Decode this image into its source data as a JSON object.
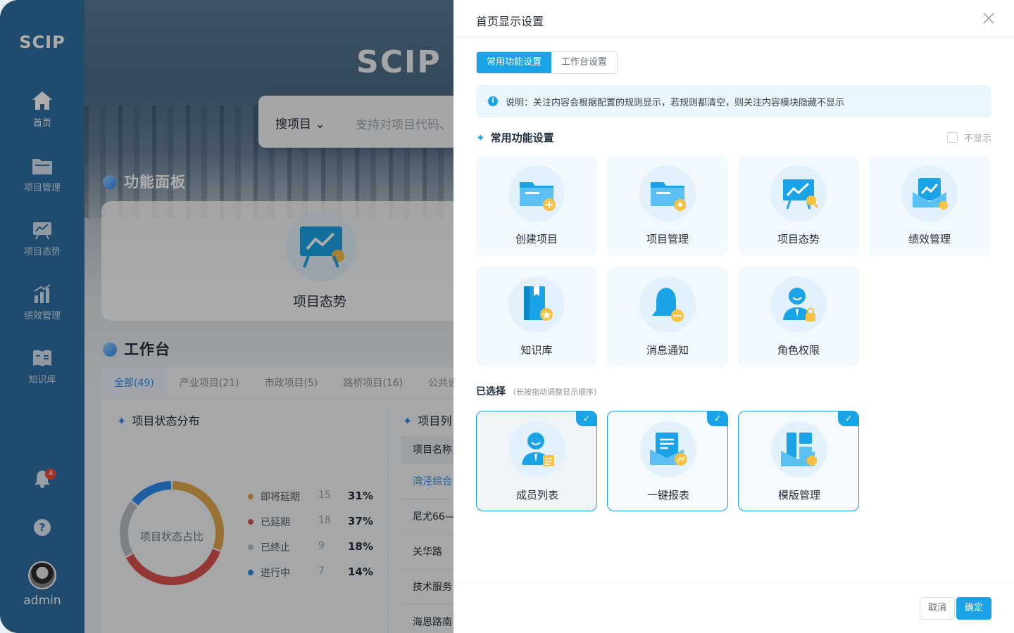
{
  "sidebar": {
    "logo": "SCIP",
    "items": [
      {
        "label": "首页",
        "icon": "home-icon"
      },
      {
        "label": "项目管理",
        "icon": "folder-icon"
      },
      {
        "label": "项目态势",
        "icon": "trend-board-icon"
      },
      {
        "label": "绩效管理",
        "icon": "bar-chart-icon"
      },
      {
        "label": "知识库",
        "icon": "book-icon"
      }
    ],
    "notification_count": "4",
    "help_icon": "question-icon",
    "user": "admin"
  },
  "background": {
    "hero_logo": "SCIP 建",
    "search": {
      "select_label": "搜项目",
      "placeholder": "支持对项目代码、"
    },
    "panel_title": "功能面板",
    "panel_card_label": "项目态势",
    "work_title": "工作台",
    "tabs": [
      "全部(49)",
      "产业项目(21)",
      "市政项目(5)",
      "路桥项目(16)",
      "公共设"
    ],
    "status_title": "项目状态分布",
    "donut_center": "项目状态占比",
    "legend": [
      {
        "label": "即将延期",
        "count": "15",
        "pct": "31%",
        "color": "#e0a84b"
      },
      {
        "label": "已延期",
        "count": "18",
        "pct": "37%",
        "color": "#d9534f"
      },
      {
        "label": "已终止",
        "count": "9",
        "pct": "18%",
        "color": "#b8bec5"
      },
      {
        "label": "进行中",
        "count": "7",
        "pct": "14%",
        "color": "#2d8cf0"
      }
    ],
    "list_title": "项目列",
    "table_header": "项目名称",
    "table_rows": [
      "湾泾综合",
      "尼尤66—",
      "关华路",
      "技术服务",
      "海思路南"
    ]
  },
  "drawer": {
    "title": "首页显示设置",
    "tabs": [
      "常用功能设置",
      "工作台设置"
    ],
    "notice": "说明：关注内容会根据配置的规则显示，若规则都清空，则关注内容模块隐藏不显示",
    "section_title": "常用功能设置",
    "hide_label": "不显示",
    "cards": [
      {
        "label": "创建项目",
        "icon": "folder-add-icon"
      },
      {
        "label": "项目管理",
        "icon": "folder-settings-icon"
      },
      {
        "label": "项目态势",
        "icon": "trend-board-icon"
      },
      {
        "label": "绩效管理",
        "icon": "performance-icon"
      },
      {
        "label": "知识库",
        "icon": "book-icon"
      },
      {
        "label": "消息通知",
        "icon": "bell-icon"
      },
      {
        "label": "角色权限",
        "icon": "user-lock-icon"
      }
    ],
    "selected_title": "已选择",
    "selected_hint": "（长按拖动调整显示顺序）",
    "selected": [
      {
        "label": "成员列表",
        "icon": "user-list-icon"
      },
      {
        "label": "一键报表",
        "icon": "report-icon"
      },
      {
        "label": "模版管理",
        "icon": "template-icon"
      }
    ],
    "cancel": "取消",
    "confirm": "确定"
  },
  "colors": {
    "accent": "#1ba3e8",
    "sidebar": "#2f6fa3"
  }
}
